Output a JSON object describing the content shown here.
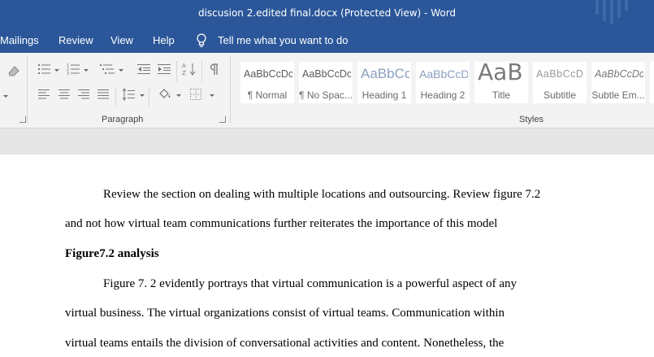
{
  "window": {
    "title": "discusion 2.edited final.docx (Protected View)  -  Word"
  },
  "menu": {
    "tabs": [
      "Mailings",
      "Review",
      "View",
      "Help"
    ],
    "tell_me": "Tell me what you want to do"
  },
  "ribbon": {
    "paragraph_label": "Paragraph",
    "styles_label": "Styles",
    "styles": [
      {
        "sample": "AaBbCcDc",
        "name": "¶ Normal"
      },
      {
        "sample": "AaBbCcDc",
        "name": "¶ No Spac..."
      },
      {
        "sample": "AaBbCc",
        "name": "Heading 1"
      },
      {
        "sample": "AaBbCcD",
        "name": "Heading 2"
      },
      {
        "sample": "AaB",
        "name": "Title"
      },
      {
        "sample": "AaBbCcD",
        "name": "Subtitle"
      },
      {
        "sample": "AaBbCcDc",
        "name": "Subtle Em..."
      }
    ]
  },
  "document": {
    "lines": [
      "Review the section on dealing with multiple locations and outsourcing. Review figure 7.2",
      "and not how virtual team communications further reiterates the importance of this model",
      "Figure7.2 analysis",
      "Figure 7. 2 evidently portrays that virtual communication is a powerful aspect of any",
      "virtual business.  The virtual organizations consist of virtual teams. Communication within",
      "virtual teams entails the division of conversational activities and content. Nonetheless, the"
    ]
  },
  "colors": {
    "accent": "#2b579a",
    "ribbon_bg": "#f3f3f3",
    "canvas_bg": "#e6e6e6"
  },
  "icons": [
    "lightbulb-icon",
    "bullets-icon",
    "numbering-icon",
    "multilevel-list-icon",
    "decrease-indent-icon",
    "increase-indent-icon",
    "sort-icon",
    "show-formatting-icon",
    "align-left-icon",
    "center-icon",
    "align-right-icon",
    "justify-icon",
    "line-spacing-icon",
    "shading-icon",
    "borders-icon",
    "eraser-icon"
  ]
}
